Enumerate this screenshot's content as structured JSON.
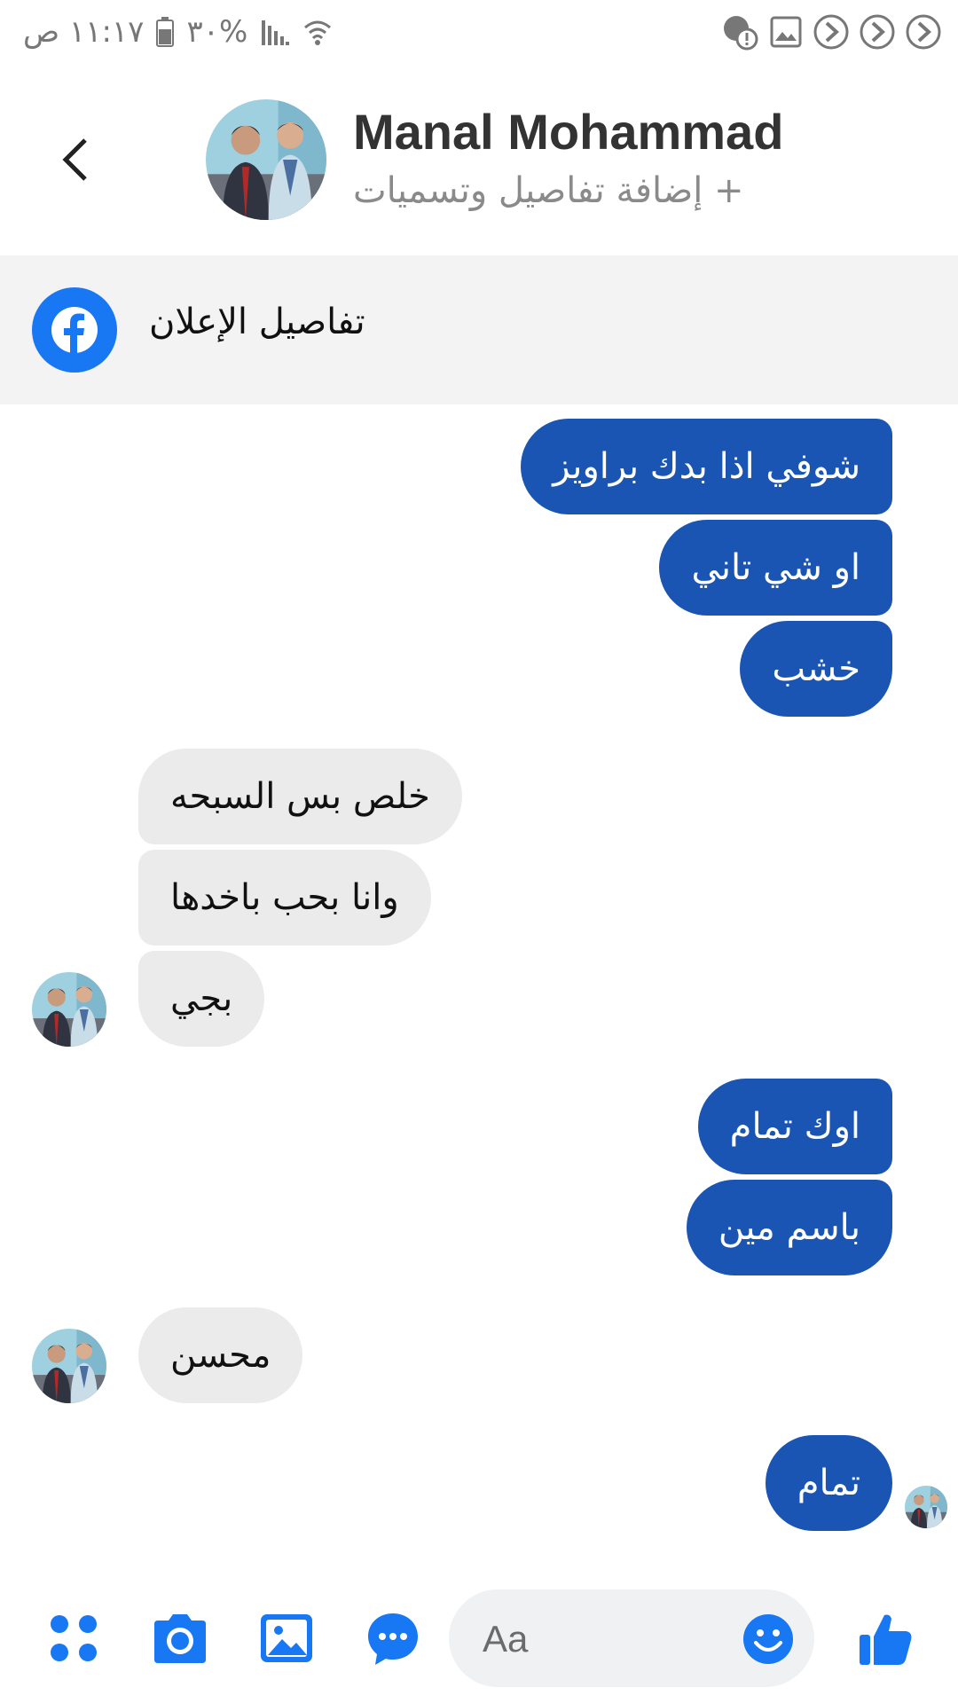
{
  "status_bar": {
    "time": "١١:١٧ ص",
    "battery": "٣٠%",
    "icons": [
      "battery-icon",
      "signal-icon",
      "wifi-icon",
      "alert-icon",
      "image-notification-icon",
      "arrow-notification-icon"
    ]
  },
  "header": {
    "back_icon": "chevron-left-icon",
    "title": "Manal Mohammad",
    "subtitle": "+ إضافة تفاصيل وتسميات"
  },
  "ad_banner": {
    "icon": "facebook-icon",
    "label": "تفاصيل الإعلان"
  },
  "messages": [
    {
      "direction": "outgoing",
      "text": "شوفي اذا بدك براويز"
    },
    {
      "direction": "outgoing",
      "text": "او شي تاني"
    },
    {
      "direction": "outgoing",
      "text": "خشب"
    },
    {
      "direction": "incoming",
      "text": "خلص بس السبحه"
    },
    {
      "direction": "incoming",
      "text": "وانا بحب باخدها"
    },
    {
      "direction": "incoming",
      "text": "بجي"
    },
    {
      "direction": "outgoing",
      "text": "اوك تمام"
    },
    {
      "direction": "outgoing",
      "text": "باسم مين"
    },
    {
      "direction": "incoming",
      "text": "محسن"
    },
    {
      "direction": "outgoing",
      "text": "تمام"
    }
  ],
  "composer": {
    "placeholder": "Aa",
    "icons": [
      "menu-dots-icon",
      "camera-icon",
      "gallery-icon",
      "voice-message-icon",
      "emoji-icon",
      "thumbs-up-icon"
    ]
  },
  "colors": {
    "outgoing_bubble": "#1a55b3",
    "incoming_bubble": "#ebebeb",
    "accent": "#1877f2"
  }
}
